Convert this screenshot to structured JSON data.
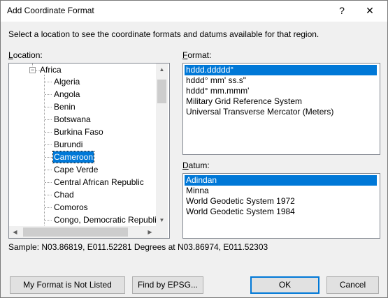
{
  "window": {
    "title": "Add Coordinate Format",
    "help_glyph": "?",
    "close_glyph": "✕"
  },
  "description": "Select a location to see the coordinate formats and datums available for that region.",
  "location": {
    "label_accel": "L",
    "label_rest": "ocation:",
    "root": "Africa",
    "expander_glyph": "−",
    "items": [
      "Algeria",
      "Angola",
      "Benin",
      "Botswana",
      "Burkina Faso",
      "Burundi",
      "Cameroon",
      "Cape Verde",
      "Central African Republic",
      "Chad",
      "Comoros",
      "Congo, Democratic Republi"
    ],
    "selected": "Cameroon"
  },
  "format": {
    "label_accel": "F",
    "label_rest": "ormat:",
    "items": [
      "hddd.ddddd°",
      "hddd° mm' ss.s\"",
      "hddd° mm.mmm'",
      "Military Grid Reference System",
      "Universal Transverse Mercator (Meters)"
    ],
    "selected": "hddd.ddddd°"
  },
  "datum": {
    "label_accel": "D",
    "label_rest": "atum:",
    "items": [
      "Adindan",
      "Minna",
      "World Geodetic System 1972",
      "World Geodetic System 1984"
    ],
    "selected": "Adindan"
  },
  "sample": "Sample: N03.86819, E011.52281 Degrees at N03.86974, E011.52303",
  "buttons": {
    "not_listed": "My Format is Not Listed",
    "epsg": "Find by EPSG...",
    "ok": "OK",
    "cancel": "Cancel"
  },
  "scroll_glyphs": {
    "up": "▲",
    "down": "▼",
    "left": "◀",
    "right": "▶"
  },
  "colors": {
    "selection": "#0078d7",
    "dialog_bg": "#f0f0f0"
  }
}
